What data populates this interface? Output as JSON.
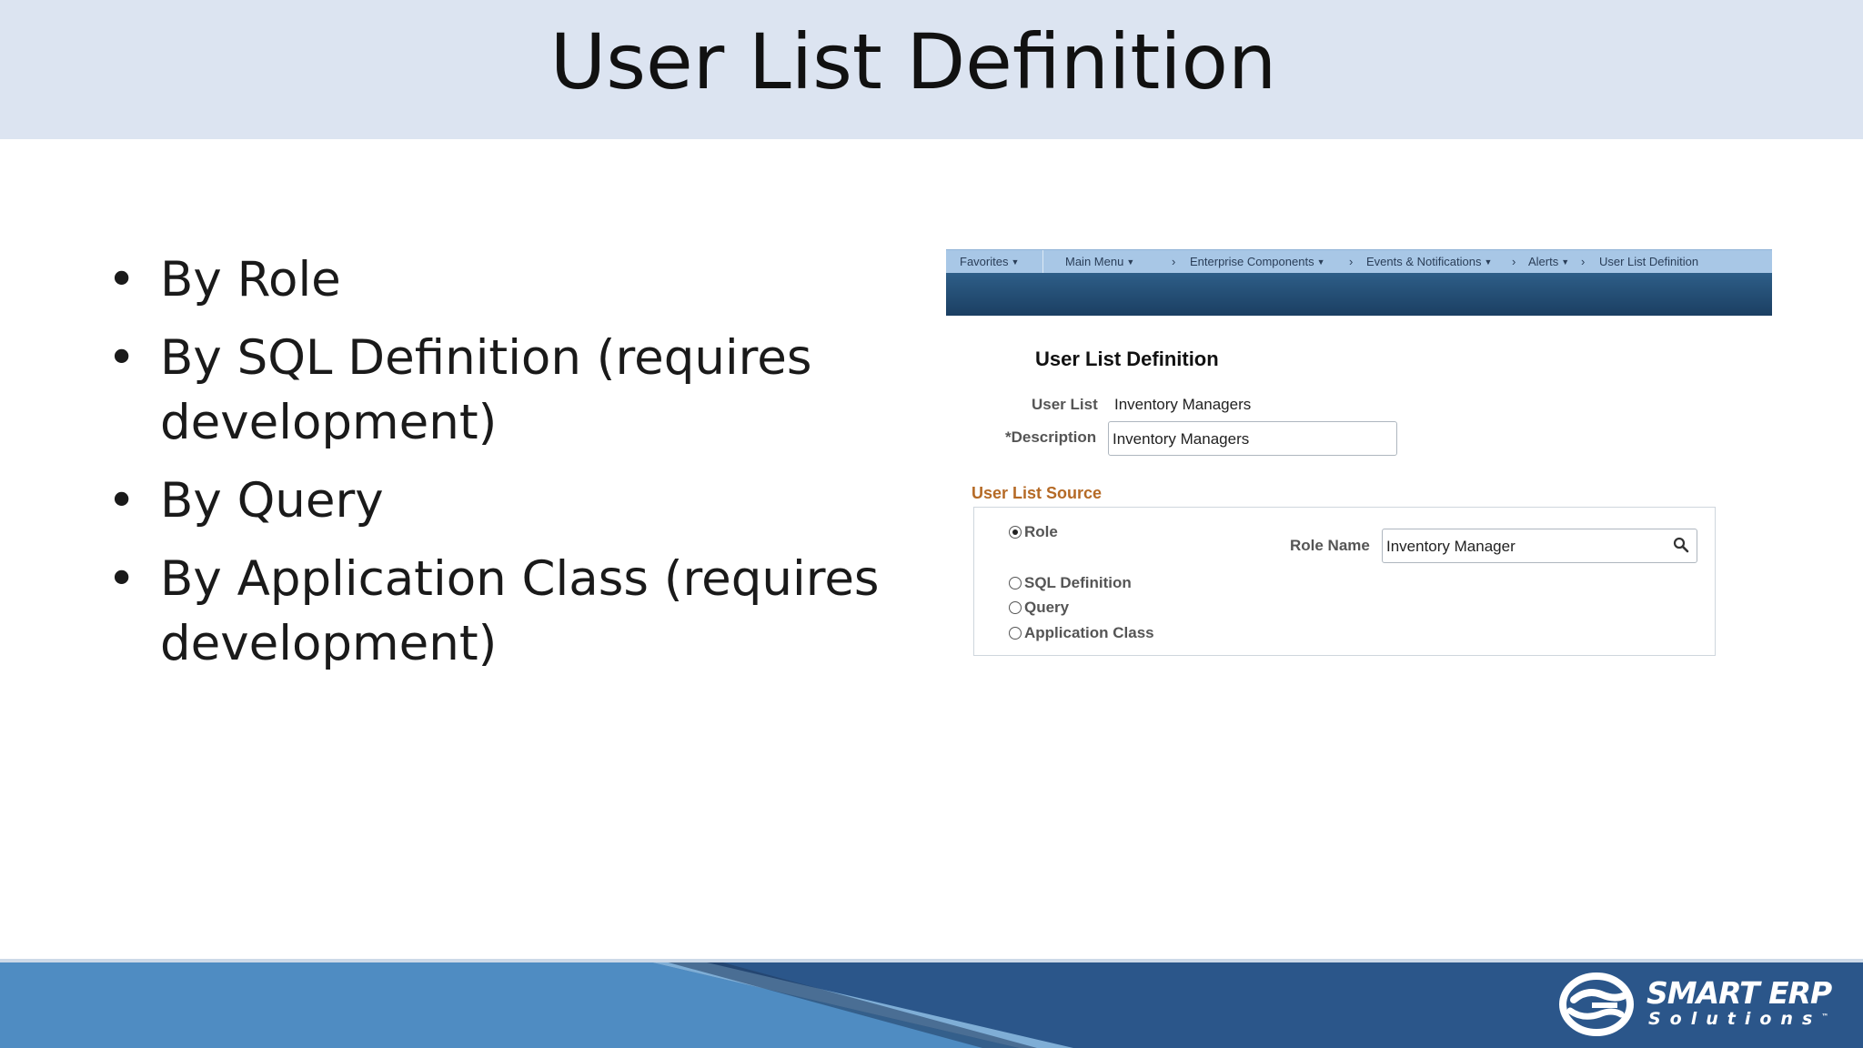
{
  "slide": {
    "title": "User List Definition",
    "bullets": [
      "By Role",
      "By SQL Definition (requires development)",
      "By Query",
      "By Application Class (requires development)"
    ]
  },
  "screenshot": {
    "nav": {
      "favorites": "Favorites",
      "main_menu": "Main Menu",
      "breadcrumbs": [
        "Enterprise Components",
        "Events & Notifications",
        "Alerts",
        "User List Definition"
      ]
    },
    "page_title": "User List Definition",
    "user_list_label": "User List",
    "user_list_value": "Inventory Managers",
    "description_label": "*Description",
    "description_value": "Inventory Managers",
    "source_section_title": "User List Source",
    "radio_options": [
      "Role",
      "SQL Definition",
      "Query",
      "Application Class"
    ],
    "selected_option": "Role",
    "role_name_label": "Role Name",
    "role_name_value": "Inventory Manager"
  },
  "footer": {
    "logo_line1": "SMART ERP",
    "logo_line2": "Solutions",
    "trademark": "™"
  },
  "colors": {
    "title_band": "#dce4f1",
    "footer": "#2d5f94",
    "section_title": "#b56a26",
    "nav_bar": "#a8c7e6",
    "banner": "#1b3f62"
  }
}
